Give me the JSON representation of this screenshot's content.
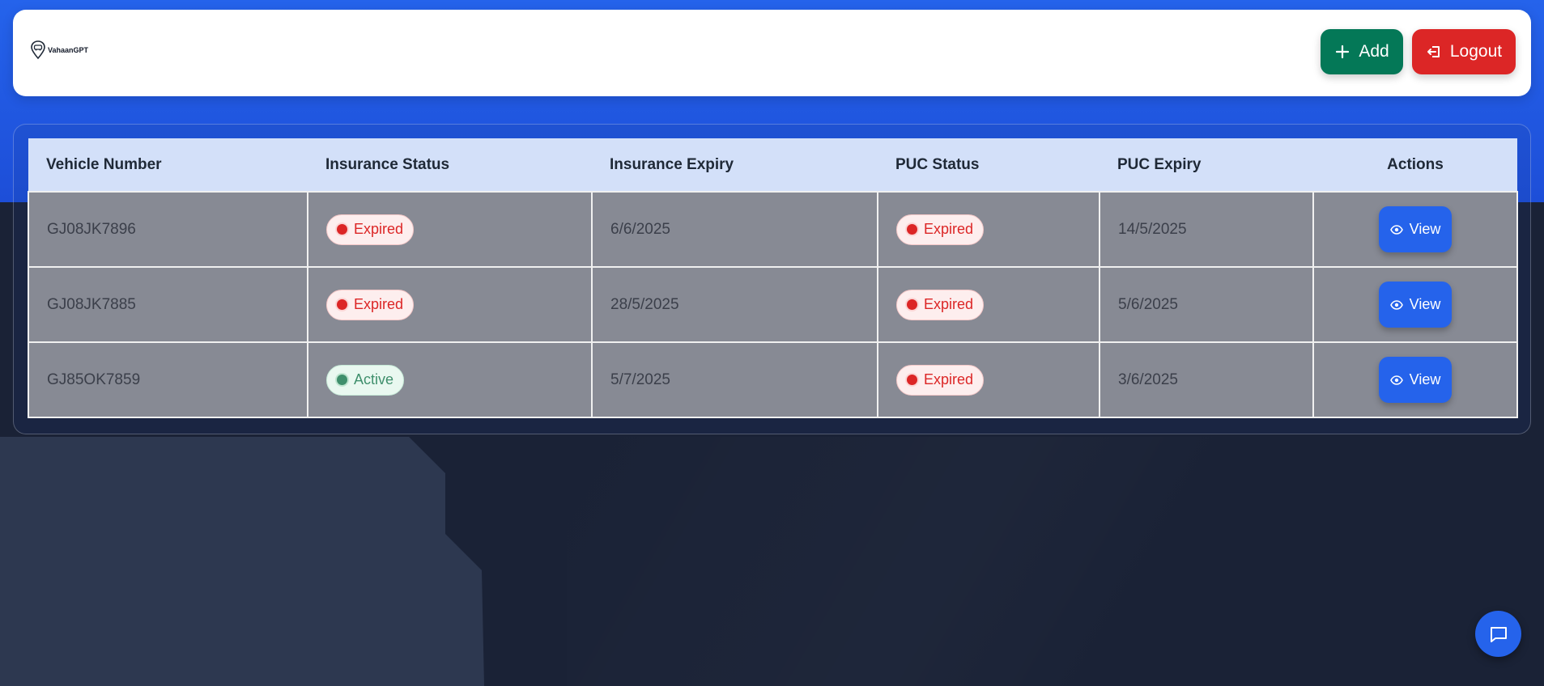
{
  "brand": {
    "name": "VahaanGPT",
    "icon": "car-pin-logo"
  },
  "header": {
    "add_label": "Add",
    "add_icon": "plus-icon",
    "logout_label": "Logout",
    "logout_icon": "logout-icon"
  },
  "table": {
    "columns": [
      "Vehicle Number",
      "Insurance Status",
      "Insurance Expiry",
      "PUC Status",
      "PUC Expiry",
      "Actions"
    ],
    "rows": [
      {
        "vehicle": "GJ08JK7896",
        "insurance_status": "Expired",
        "insurance_expiry": "6/6/2025",
        "puc_status": "Expired",
        "puc_expiry": "14/5/2025",
        "action": "View"
      },
      {
        "vehicle": "GJ08JK7885",
        "insurance_status": "Expired",
        "insurance_expiry": "28/5/2025",
        "puc_status": "Expired",
        "puc_expiry": "5/6/2025",
        "action": "View"
      },
      {
        "vehicle": "GJ85OK7859",
        "insurance_status": "Active",
        "insurance_expiry": "5/7/2025",
        "puc_status": "Expired",
        "puc_expiry": "3/6/2025",
        "action": "View"
      }
    ]
  },
  "colors": {
    "primary": "#2563eb",
    "add": "#047857",
    "logout": "#dc2626",
    "expired": "#dc2626",
    "active": "#3f8f6c"
  },
  "chat": {
    "icon": "chat-bubble-icon"
  }
}
